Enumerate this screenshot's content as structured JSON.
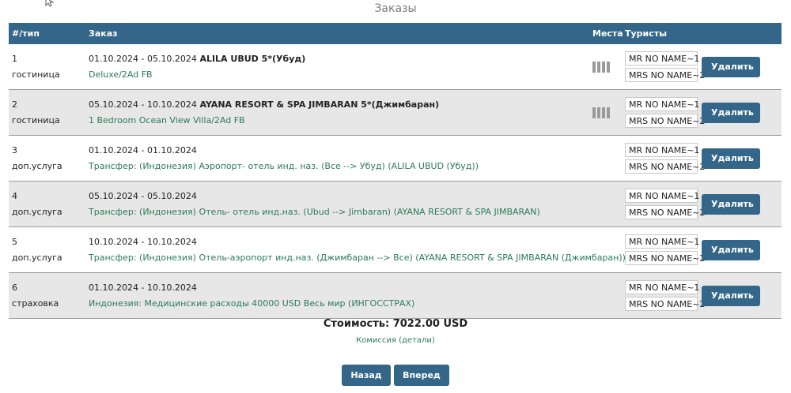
{
  "page": {
    "title": "Заказы"
  },
  "table": {
    "headers": {
      "num_type": "#/тип",
      "order": "Заказ",
      "places": "Места",
      "tourists": "Туристы"
    },
    "rows": [
      {
        "num": "1",
        "type": "гостиница",
        "dates": "01.10.2024 - 05.10.2024",
        "name": "ALILA UBUD 5*(Убуд)",
        "desc": "Deluxe/2Ad FB",
        "has_places": true,
        "tourists": [
          "MR NO NAME~1",
          "MRS NO NAME~2"
        ],
        "delete_label": "Удалить"
      },
      {
        "num": "2",
        "type": "гостиница",
        "dates": "05.10.2024 - 10.10.2024",
        "name": "AYANA RESORT & SPA JIMBARAN 5*(Джимбаран)",
        "desc": "1 Bedroom Ocean View Villa/2Ad FB",
        "has_places": true,
        "tourists": [
          "MR NO NAME~1",
          "MRS NO NAME~2"
        ],
        "delete_label": "Удалить"
      },
      {
        "num": "3",
        "type": "доп.услуга",
        "dates": "01.10.2024 - 01.10.2024",
        "name": "",
        "desc": "Трансфер: (Индонезия) Аэропорт- отель инд. наз. (Все --> Убуд) (ALILA UBUD (Убуд))",
        "has_places": false,
        "tourists": [
          "MR NO NAME~1",
          "MRS NO NAME~2"
        ],
        "delete_label": "Удалить"
      },
      {
        "num": "4",
        "type": "доп.услуга",
        "dates": "05.10.2024 - 05.10.2024",
        "name": "",
        "desc": "Трансфер: (Индонезия) Отель- отель инд.наз. (Ubud --> Jimbaran) (AYANA RESORT & SPA JIMBARAN)",
        "has_places": false,
        "tourists": [
          "MR NO NAME~1",
          "MRS NO NAME~2"
        ],
        "delete_label": "Удалить"
      },
      {
        "num": "5",
        "type": "доп.услуга",
        "dates": "10.10.2024 - 10.10.2024",
        "name": "",
        "desc": "Трансфер: (Индонезия) Отель-аэропорт инд.наз. (Джимбаран --> Все) (AYANA RESORT & SPA JIMBARAN (Джимбаран))",
        "has_places": false,
        "tourists": [
          "MR NO NAME~1",
          "MRS NO NAME~2"
        ],
        "delete_label": "Удалить"
      },
      {
        "num": "6",
        "type": "страховка",
        "dates": "01.10.2024 - 10.10.2024",
        "name": "",
        "desc": "Индонезия: Медицинские расходы 40000 USD Весь мир (ИНГОССТРАХ)",
        "has_places": false,
        "tourists": [
          "MR NO NAME~1",
          "MRS NO NAME~2"
        ],
        "delete_label": "Удалить"
      }
    ]
  },
  "summary": {
    "cost": "Стоимость: 7022.00 USD",
    "commission": "Комиссия (детали)"
  },
  "nav": {
    "back_label": "Назад",
    "next_label": "Вперед"
  },
  "colors": {
    "header": "#336688",
    "button": "#336688",
    "link": "#2b7a5a",
    "row_alt": "#e7e7e7"
  }
}
